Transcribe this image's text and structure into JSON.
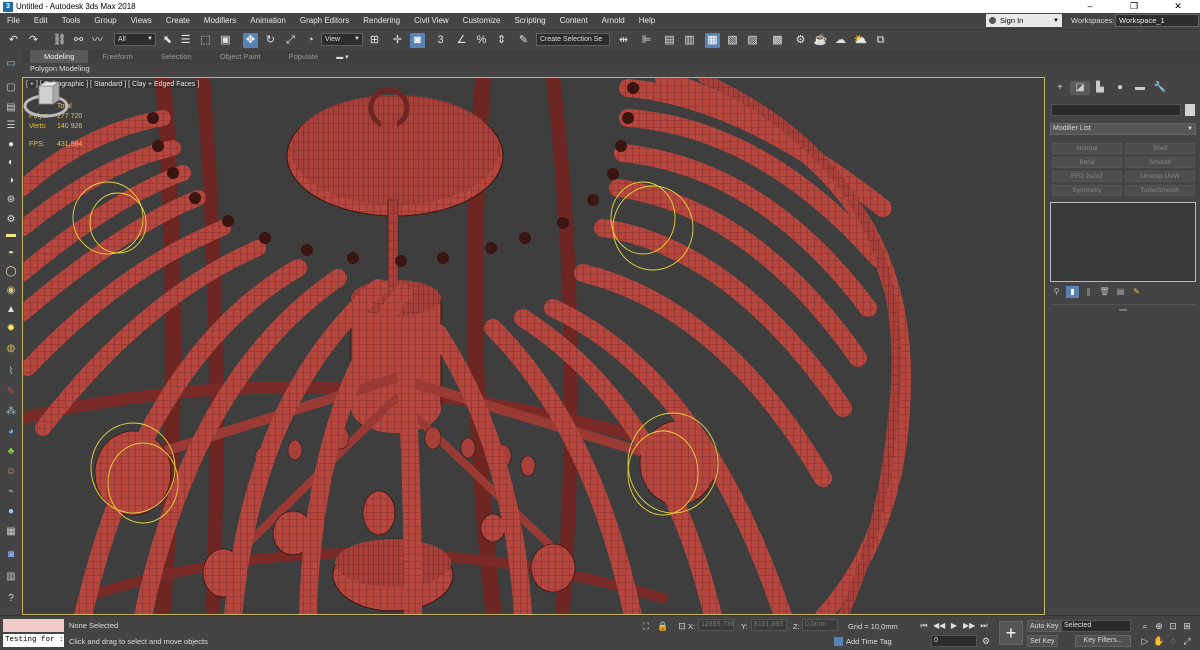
{
  "window": {
    "title": "Untitled - Autodesk 3ds Max 2018",
    "app_icon_label": "3",
    "minimize": "–",
    "maximize": "❐",
    "close": "✕"
  },
  "menu": {
    "items": [
      "File",
      "Edit",
      "Tools",
      "Group",
      "Views",
      "Create",
      "Modifiers",
      "Animation",
      "Graph Editors",
      "Rendering",
      "Civil View",
      "Customize",
      "Scripting",
      "Content",
      "Arnold",
      "Help"
    ],
    "sign_in": "Sign In",
    "workspaces_label": "Workspaces:",
    "workspace_value": "Workspace_1"
  },
  "toolbar": {
    "filter_value": "All",
    "view_value": "View",
    "selection_set_value": "Create Selection Se",
    "angle_snap": "3",
    "percent_snap": "%"
  },
  "ribbon": {
    "tabs": [
      "Modeling",
      "Freeform",
      "Selection",
      "Object Paint",
      "Populate"
    ],
    "active_tab": "Modeling",
    "sub_label": "Polygon Modeling"
  },
  "viewport": {
    "label": "[ + ] [ Orthographic ] [ Standard ] [ Clay + Edged Faces ]",
    "stats": {
      "total_label": "Total",
      "polys_label": "Polys:",
      "polys_value": "277 720",
      "verts_label": "Verts:",
      "verts_value": "140 926",
      "fps_label": "FPS:",
      "fps_value": "431,984"
    },
    "colors": {
      "background": "#3e3e3e",
      "model": "#b5473f",
      "model_dark": "#7a2a26",
      "wire": "#3a1512",
      "light_gizmo": "#e8d43c",
      "border": "#c8b560"
    }
  },
  "command_panel": {
    "modifier_list": "Modifier List",
    "buttons": [
      "Normal",
      "Shell",
      "Bend",
      "Smooth",
      "FFD 2x2x2",
      "Unwrap UVW",
      "Symmetry",
      "TurboSmooth"
    ]
  },
  "status": {
    "maxscript_text": "Testing for :",
    "selection": "None Selected",
    "prompt": "Click and drag to select and move objects",
    "x_label": "X:",
    "x_value": "12895,736",
    "y_label": "Y:",
    "y_value": "8161,893",
    "z_label": "Z:",
    "z_value": "0,0mm",
    "grid": "Grid = 10,0mm",
    "add_time_tag": "Add Time Tag",
    "frame_value": "0",
    "auto_key": "Auto Key",
    "set_key": "Set Key",
    "selected": "Selected",
    "key_filters": "Key Filters..."
  }
}
